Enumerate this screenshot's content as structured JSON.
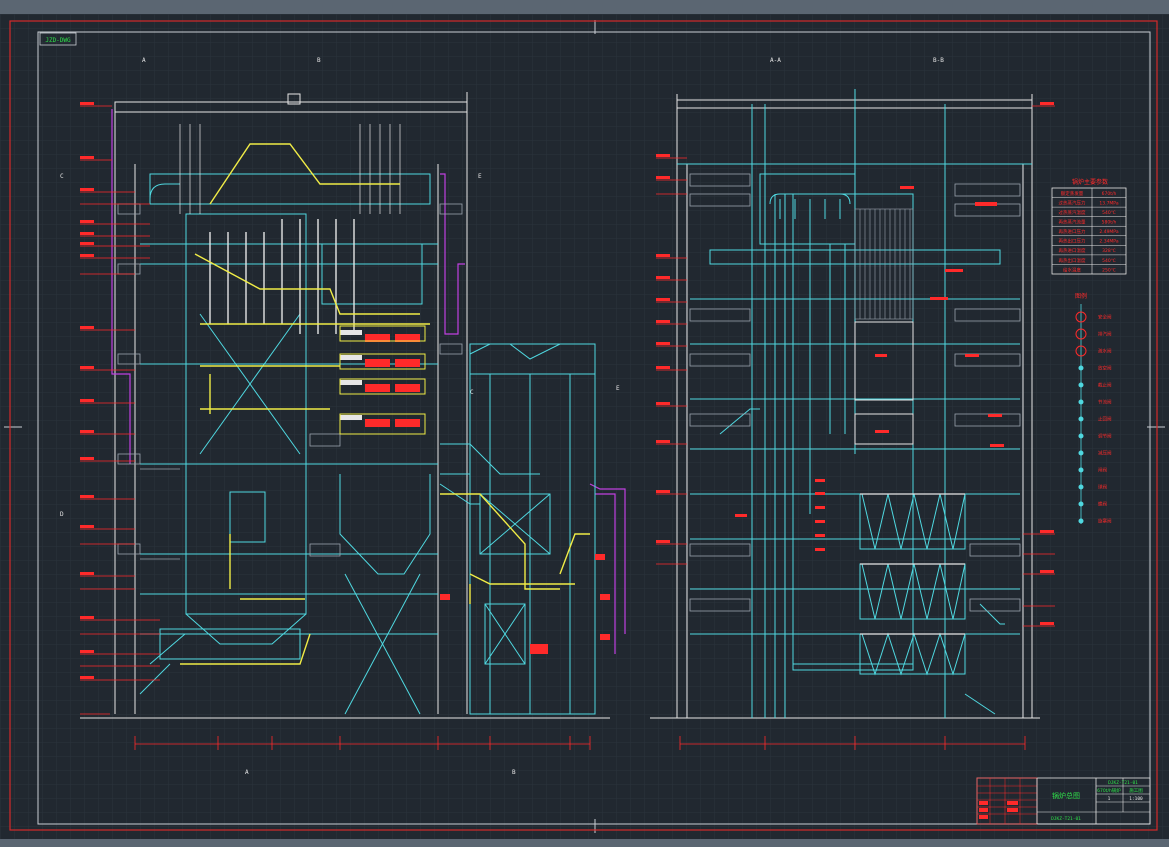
{
  "colors": {
    "background": "#212830",
    "grid": "#2b333d",
    "frame_red": "#d42a2a",
    "frame_white": "#c9ced4",
    "cyan": "#4fd8e0",
    "yellow": "#f0ec46",
    "red": "#ff2a2a",
    "white": "#e6e6e6",
    "magenta": "#c040e0",
    "green": "#2fe04a",
    "chrome": "#5b6672"
  },
  "drawing": {
    "drawing_label": "JZD-DWG",
    "left_view": {
      "axis_labels": [
        "A",
        "B",
        "C",
        "D",
        "A",
        "B",
        "C",
        "E",
        "E"
      ]
    },
    "right_view": {
      "section_labels": [
        "A-A",
        "B-B"
      ]
    },
    "main_parameters_title": "锅炉主要参数",
    "main_parameters": [
      {
        "name": "额定蒸发量",
        "value": "670t/h"
      },
      {
        "name": "过热蒸汽压力",
        "value": "13.7MPa"
      },
      {
        "name": "过热蒸汽温度",
        "value": "540℃"
      },
      {
        "name": "再热蒸汽流量",
        "value": "580t/h"
      },
      {
        "name": "再热进口压力",
        "value": "2.49MPa"
      },
      {
        "name": "再热出口压力",
        "value": "2.34MPa"
      },
      {
        "name": "再热进口温度",
        "value": "328℃"
      },
      {
        "name": "再热出口温度",
        "value": "540℃"
      },
      {
        "name": "给水温度",
        "value": "250℃"
      }
    ],
    "legend_title": "图例",
    "legend_items": [
      "安全阀",
      "排汽阀",
      "疏水阀",
      "放空阀",
      "截止阀",
      "节流阀",
      "止回阀",
      "调节阀",
      "减压阀",
      "闸阀",
      "球阀",
      "蝶阀",
      "旋塞阀"
    ],
    "title_block": {
      "drawing_title": "锅炉总图",
      "drawing_number": "DJKZ-T21-01",
      "project": "670t/h锅炉",
      "stage": "施工图",
      "sheet": "1",
      "scale": "1:100",
      "footer_code": "DJKZ-T21-01"
    }
  }
}
